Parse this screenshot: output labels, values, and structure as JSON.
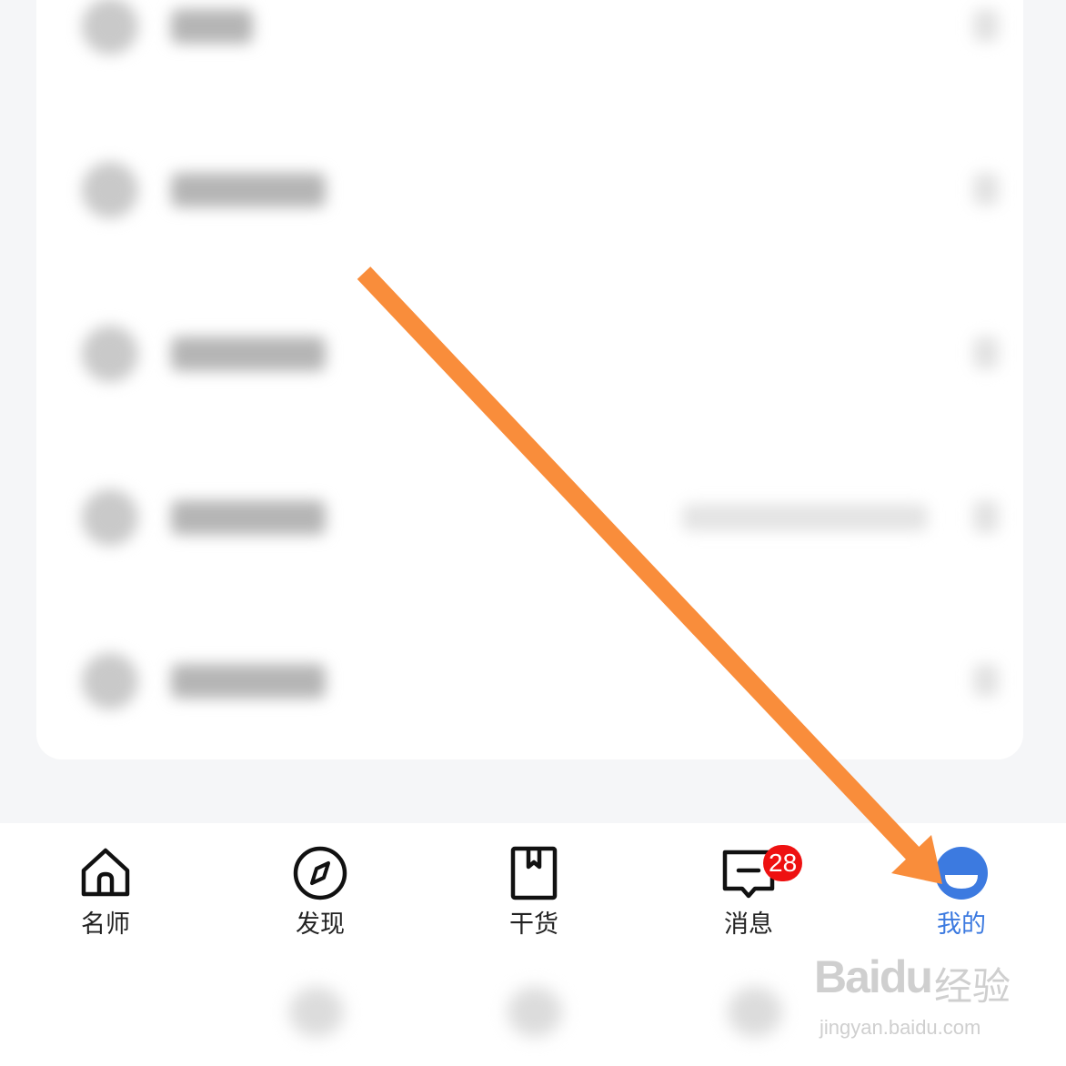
{
  "tabs": [
    {
      "id": "home",
      "label": "名师",
      "icon": "home-icon",
      "active": false
    },
    {
      "id": "discover",
      "label": "发现",
      "icon": "compass-icon",
      "active": false
    },
    {
      "id": "content",
      "label": "干货",
      "icon": "bookmark-book-icon",
      "active": false
    },
    {
      "id": "messages",
      "label": "消息",
      "icon": "message-icon",
      "active": false,
      "badge": "28"
    },
    {
      "id": "mine",
      "label": "我的",
      "icon": "profile-face-icon",
      "active": true
    }
  ],
  "colors": {
    "active": "#3c7ae0",
    "badge": "#ee1111",
    "arrow": "#f98d3b"
  },
  "watermark": {
    "brand": "Bai",
    "brand_mid": "du",
    "cn": "经验",
    "url": "jingyan.baidu.com"
  }
}
